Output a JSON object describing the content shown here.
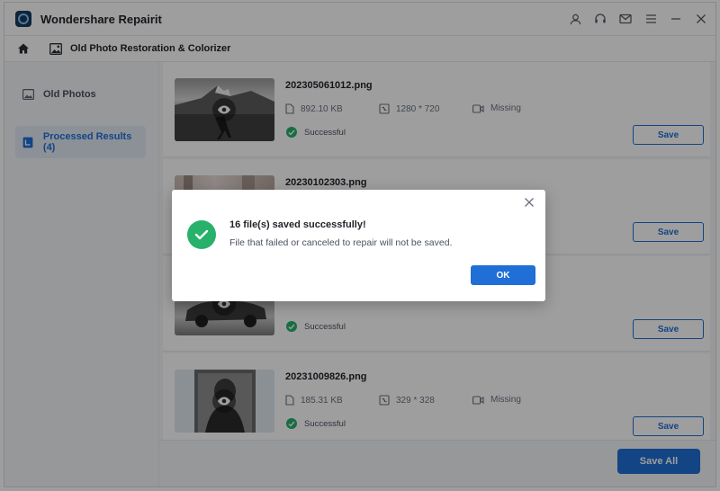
{
  "app": {
    "title": "Wondershare Repairit"
  },
  "titlebar": {
    "icons": [
      "user-icon",
      "headset-icon",
      "mail-icon",
      "menu-icon",
      "minimize-icon",
      "close-icon"
    ]
  },
  "navbar": {
    "feature_title": "Old Photo Restoration & Colorizer"
  },
  "sidebar": {
    "items": [
      {
        "label": "Old Photos",
        "icon": "image-icon"
      },
      {
        "label": "Processed Results (4)",
        "icon": "results-icon"
      }
    ]
  },
  "files": [
    {
      "name": "202305061012.png",
      "size": "892.10  KB",
      "resolution": "1280 * 720",
      "audio": "Missing",
      "status": "Successful",
      "save_label": "Save"
    },
    {
      "name": "20230102303.png",
      "size": "",
      "resolution": "",
      "audio": "",
      "status": "",
      "save_label": "Save"
    },
    {
      "name": "",
      "size": "",
      "resolution": "",
      "audio": "",
      "status": "Successful",
      "save_label": "Save"
    },
    {
      "name": "20231009826.png",
      "size": "185.31  KB",
      "resolution": "329 * 328",
      "audio": "Missing",
      "status": "Successful",
      "save_label": "Save"
    }
  ],
  "bottom": {
    "save_all_label": "Save All"
  },
  "dialog": {
    "title": "16 file(s) saved successfully!",
    "message": "File that failed or canceled to repair will not be saved.",
    "ok_label": "OK"
  },
  "colors": {
    "accent": "#1f6fd6",
    "success": "#27b16b",
    "overlay": "rgba(0,0,0,0.38)"
  }
}
